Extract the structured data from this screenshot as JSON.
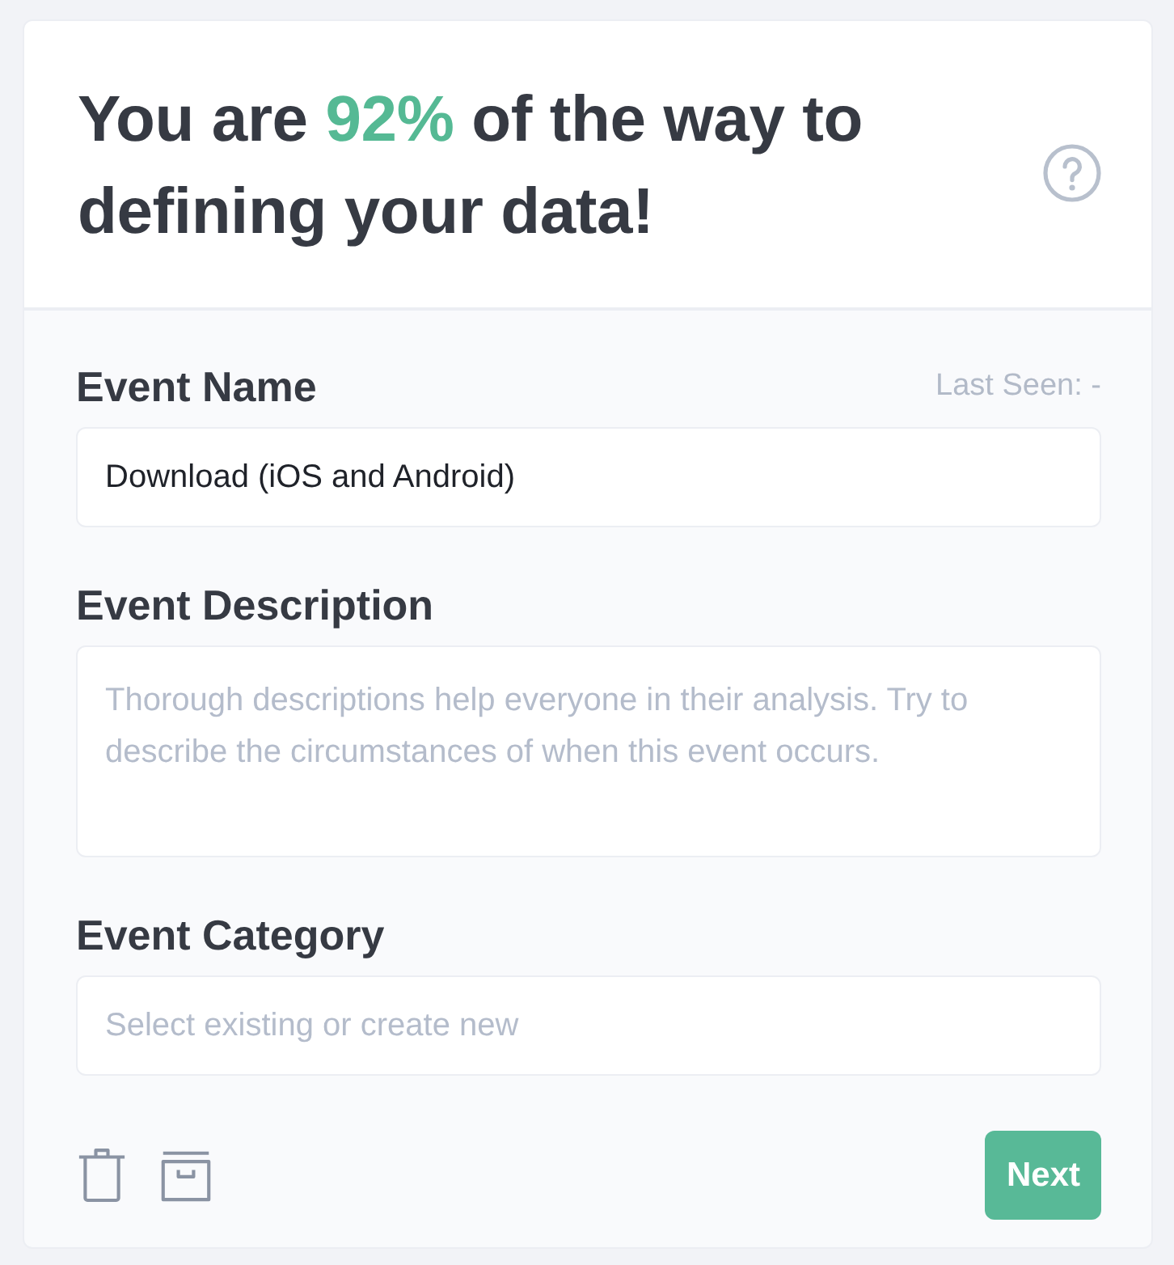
{
  "header": {
    "title": {
      "before": "You are ",
      "highlight": "92%",
      "after": " of the way to defining your data!"
    }
  },
  "fields": [
    {
      "kind": "text",
      "label": "Event Name",
      "meta": "Last Seen: -",
      "value": "Download (iOS and Android)"
    },
    {
      "kind": "textarea",
      "label": "Event Description",
      "placeholder": "Thorough descriptions help everyone in their analysis. Try to describe the circumstances of when this event occurs."
    },
    {
      "kind": "text",
      "label": "Event Category",
      "placeholder": "Select existing or create new"
    }
  ],
  "footer": {
    "next_button": "Next"
  }
}
